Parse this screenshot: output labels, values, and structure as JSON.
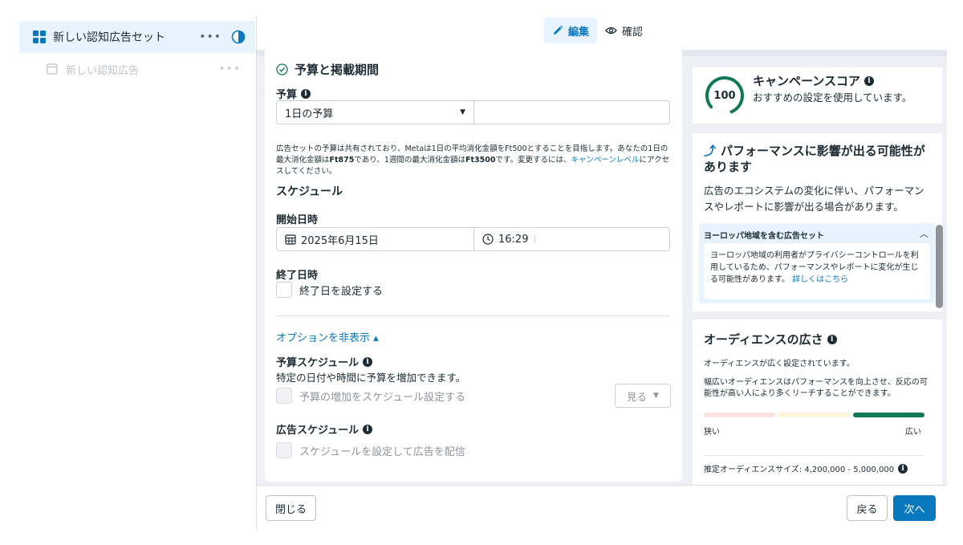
{
  "tree": {
    "adset": {
      "label": "新しい認知広告セット",
      "more": "•••"
    },
    "ad": {
      "label": "新しい認知広告",
      "more": "•••"
    }
  },
  "mode_tabs": {
    "edit": "編集",
    "review": "確認"
  },
  "budget_section": {
    "title": "予算と掲載期間",
    "budget_label": "予算",
    "budget_type": "1日の予算",
    "budget_amount": "",
    "helper_parts": [
      "広告セットの予算は共有されており、Metaは1日の平均消化金額をFt500とすることを目指します。あなたの1日の最大消化金額は",
      "Ft875",
      "であり、1週間の最大消化金額は",
      "Ft3500",
      "です。変更するには、",
      "キャンペーンレベル",
      "にアクセスしてください。"
    ],
    "schedule_heading": "スケジュール",
    "start_label": "開始日時",
    "start_date": "2025年6月15日",
    "start_time": "16:29",
    "end_label": "終了日時",
    "end_checkbox": "終了日を設定する",
    "options_toggle": "オプションを非表示 ▴",
    "budget_schedule_label": "予算スケジュール",
    "budget_schedule_desc": "特定の日付や時間に予算を増加できます。",
    "budget_schedule_checkbox": "予算の増加をスケジュール設定する",
    "see_button": "見る",
    "ad_schedule_label": "広告スケジュール",
    "ad_schedule_checkbox": "スケジュールを設定して広告を配信"
  },
  "score_card": {
    "score": "100",
    "title": "キャンペーンスコア",
    "subtitle": "おすすめの設定を使用しています。"
  },
  "performance_card": {
    "title": "パフォーマンスに影響が出る可能性があります",
    "desc": "広告のエコシステムの変化に伴い、パフォーマンスやレポートに影響が出る場合があります。",
    "eu_heading": "ヨーロッパ地域を含む広告セット",
    "eu_body": "ヨーロッパ地域の利用者がプライバシーコントロールを利用しているため、パフォーマンスやレポートに変化が生じる可能性があります。",
    "eu_link": "詳しくはこちら"
  },
  "audience_card": {
    "title": "オーディエンスの広さ",
    "subtitle": "オーディエンスが広く設定されています。",
    "desc": "幅広いオーディエンスはパフォーマンスを向上させ、反応の可能性が高い人により多くリーチすることができます。",
    "narrow": "狭い",
    "wide": "広い",
    "size": "推定オーディエンスサイズ: 4,200,000 - 5,000,000",
    "meter_colors": [
      "#fbe3e4",
      "#fdf3d8",
      "#117a55"
    ]
  },
  "footer": {
    "close": "閉じる",
    "back": "戻る",
    "next": "次へ"
  },
  "colors": {
    "accent": "#0a78be",
    "score_ring": "#117a55",
    "selected_row": "#e7f3ff"
  }
}
